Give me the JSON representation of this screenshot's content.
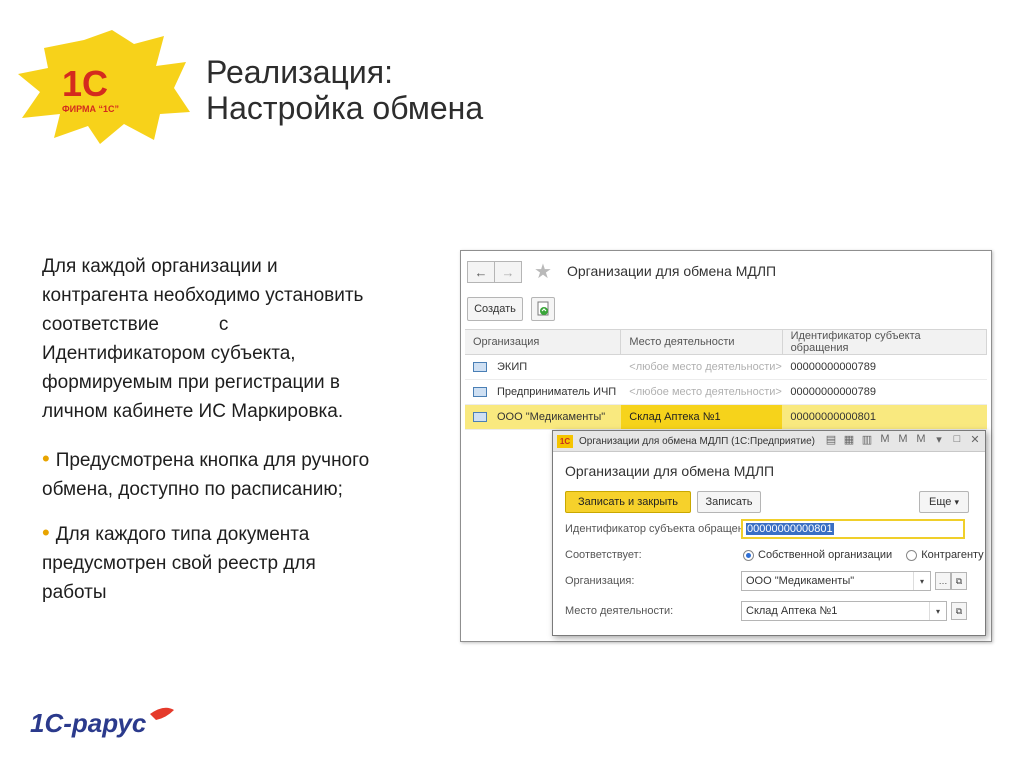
{
  "slide": {
    "title_line1": "Реализация:",
    "title_line2": "Настройка обмена",
    "logo_1c_text": "1С",
    "logo_1c_firm": "ФИРМА “1С”",
    "logo_rarus": "1С-рарус",
    "paragraph_line1": "Для каждой организации и",
    "paragraph_line2": "контрагента необходимо установить",
    "paragraph_line3a": "соответствие",
    "paragraph_line3b": "с",
    "paragraph_line4": "Идентификатором субъекта,",
    "paragraph_line5": "формируемым при регистрации в",
    "paragraph_line6": "личном кабинете ИС Маркировка.",
    "bullet1_line1": "Предусмотрена кнопка для ручного",
    "bullet1_line2": "обмена, доступно по расписанию;",
    "bullet2_line1": "Для каждого типа документа",
    "bullet2_line2": "предусмотрен свой реестр для",
    "bullet2_line3": "работы",
    "bullet_color": "#e8a400"
  },
  "list_window": {
    "back_icon": "←",
    "forward_icon": "→",
    "star_icon": "★",
    "title": "Организации для обмена МДЛП",
    "create_button": "Создать",
    "columns": [
      "Организация",
      "Место деятельности",
      "Идентификатор субъекта обращения"
    ],
    "rows": [
      {
        "org": "ЭКИП",
        "place": "<любое место деятельности>",
        "id": "00000000000789"
      },
      {
        "org": "Предприниматель ИЧП",
        "place": "<любое место деятельности>",
        "id": "00000000000789"
      },
      {
        "org": "ООО \"Медикаменты\"",
        "place": "Склад Аптека №1",
        "id": "00000000000801"
      }
    ],
    "selected_row_color": "#f9e97f"
  },
  "form_window": {
    "titlebar_badge": "1С",
    "titlebar_text": "Организации для обмена МДЛП (1С:Предприятие)",
    "heading": "Организации для обмена МДЛП",
    "save_close_button": "Записать и закрыть",
    "save_button": "Записать",
    "more_button": "Еще",
    "more_arrow": "▾",
    "id_label": "Идентификатор субъекта обращения:",
    "id_value": "00000000000801",
    "match_label": "Соответствует:",
    "radio_own": "Собственной организации",
    "radio_contractor": "Контрагенту",
    "org_label": "Организация:",
    "org_value": "ООО \"Медикаменты\"",
    "place_label": "Место деятельности:",
    "place_value": "Склад Аптека №1",
    "primary_color": "#f6d12b"
  }
}
